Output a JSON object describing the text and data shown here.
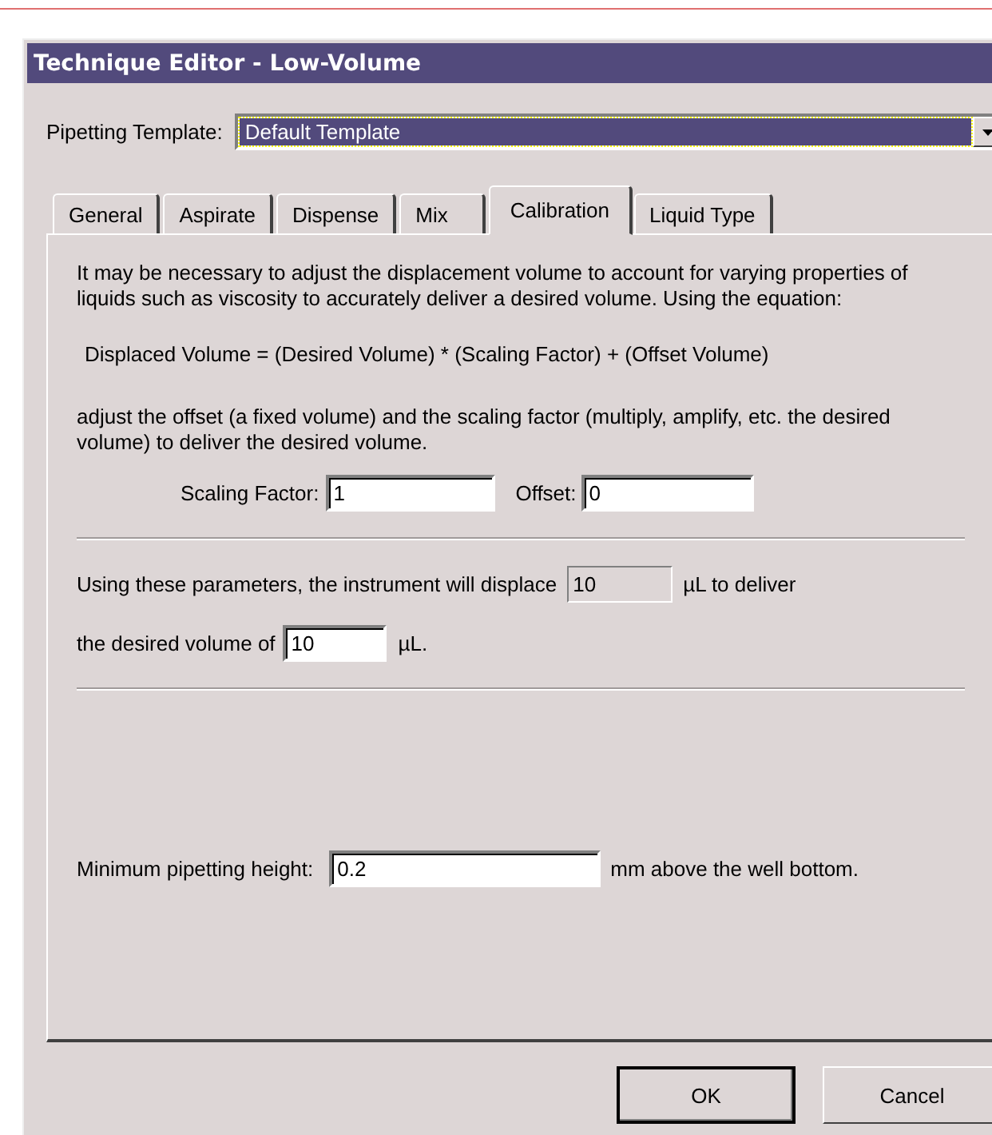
{
  "window": {
    "title": "Technique Editor - Low-Volume"
  },
  "template": {
    "label": "Pipetting Template:",
    "value": "Default Template",
    "focused": true
  },
  "tabs": [
    {
      "label": "General",
      "selected": false
    },
    {
      "label": "Aspirate",
      "selected": false
    },
    {
      "label": "Dispense",
      "selected": false
    },
    {
      "label": "Mix",
      "selected": false
    },
    {
      "label": "Calibration",
      "selected": true
    },
    {
      "label": "Liquid Type",
      "selected": false
    }
  ],
  "calibration": {
    "intro": "It may be necessary to adjust the displacement volume to account for varying properties of liquids such as viscosity to accurately deliver a desired volume. Using the equation:",
    "equation": "Displaced Volume = (Desired Volume) * (Scaling Factor) + (Offset Volume)",
    "instructions": "adjust the offset (a fixed volume) and the scaling factor (multiply, amplify, etc. the desired volume) to deliver the desired volume.",
    "scaling_factor": {
      "label": "Scaling Factor:",
      "value": "1"
    },
    "offset": {
      "label": "Offset:",
      "value": "0"
    },
    "result": {
      "text": "Using these parameters, the instrument will displace",
      "displaced": {
        "value": "10",
        "readonly": true
      },
      "unit": "µL to deliver",
      "text_2": "the desired volume of",
      "desired": {
        "value": "10",
        "readonly": false
      },
      "unit_2": "µL."
    },
    "min_height": {
      "label": "Minimum pipetting height:",
      "value": "0.2",
      "suffix": "mm above the well bottom."
    }
  },
  "buttons": [
    {
      "label": "OK",
      "default": true
    },
    {
      "label": "Cancel",
      "default": false
    }
  ]
}
